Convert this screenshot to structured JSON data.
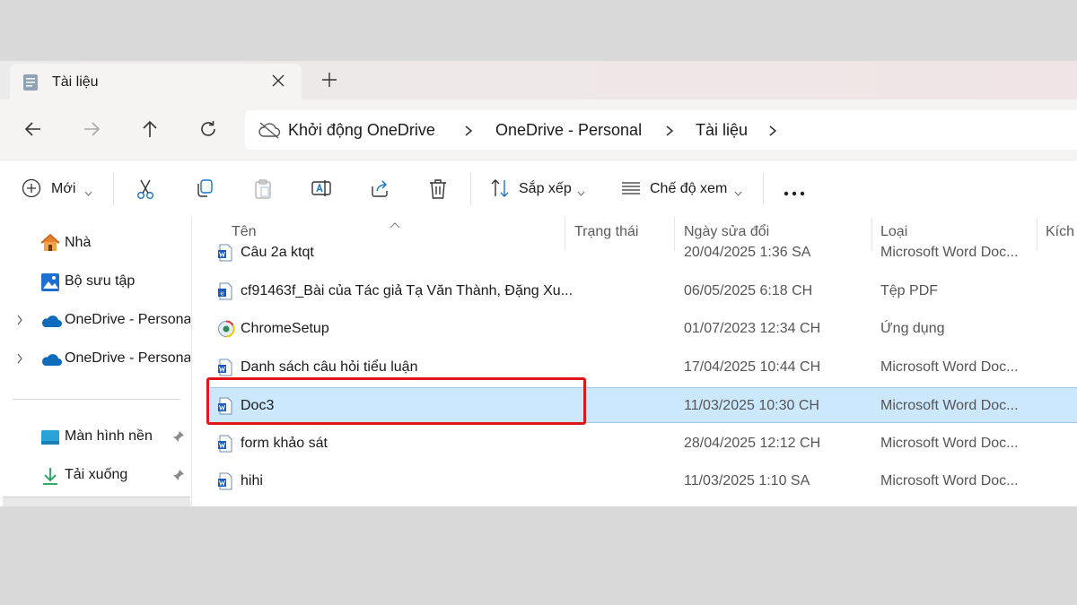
{
  "tab": {
    "title": "Tài liệu"
  },
  "address": {
    "crumbs": [
      "Khởi động OneDrive",
      "OneDrive - Personal",
      "Tài liệu"
    ]
  },
  "toolbar": {
    "new_label": "Mới",
    "sort_label": "Sắp xếp",
    "view_label": "Chế độ xem"
  },
  "sidebar": {
    "items": [
      {
        "label": "Nhà",
        "icon": "home-icon"
      },
      {
        "label": "Bộ sưu tập",
        "icon": "gallery-icon"
      },
      {
        "label": "OneDrive - Persona",
        "icon": "onedrive-icon"
      },
      {
        "label": "OneDrive - Persona",
        "icon": "onedrive-icon"
      },
      {
        "label": "Màn hình nền",
        "icon": "desktop-icon"
      },
      {
        "label": "Tải xuống",
        "icon": "download-icon"
      }
    ]
  },
  "columns": {
    "name": "Tên",
    "status": "Trạng thái",
    "modified": "Ngày sửa đổi",
    "type": "Loại",
    "size": "Kích c"
  },
  "files": [
    {
      "name": "Câu 2a ktqt",
      "modified": "20/04/2025 1:36 SA",
      "type": "Microsoft Word Doc...",
      "icon": "word-doc-icon"
    },
    {
      "name": "cf91463f_Bài của Tác giả Tạ Văn Thành, Đặng Xu...",
      "modified": "06/05/2025 6:18 CH",
      "type": "Tệp PDF",
      "icon": "pdf-icon"
    },
    {
      "name": "ChromeSetup",
      "modified": "01/07/2023 12:34 CH",
      "type": "Ứng dụng",
      "icon": "installer-icon"
    },
    {
      "name": "Danh sách câu hỏi tiểu luận",
      "modified": "17/04/2025 10:44 CH",
      "type": "Microsoft Word Doc...",
      "icon": "word-doc-icon"
    },
    {
      "name": "Doc3",
      "modified": "11/03/2025 10:30 CH",
      "type": "Microsoft Word Doc...",
      "icon": "word-doc-icon",
      "selected": true
    },
    {
      "name": "form khảo sát",
      "modified": "28/04/2025 12:12 CH",
      "type": "Microsoft Word Doc...",
      "icon": "word-doc-icon"
    },
    {
      "name": "hihi",
      "modified": "11/03/2025 1:10 SA",
      "type": "Microsoft Word Doc...",
      "icon": "word-doc-icon"
    }
  ],
  "colors": {
    "selection": "#cce8ff",
    "highlight_border": "#e0161b",
    "accent": "#1a73c9"
  }
}
